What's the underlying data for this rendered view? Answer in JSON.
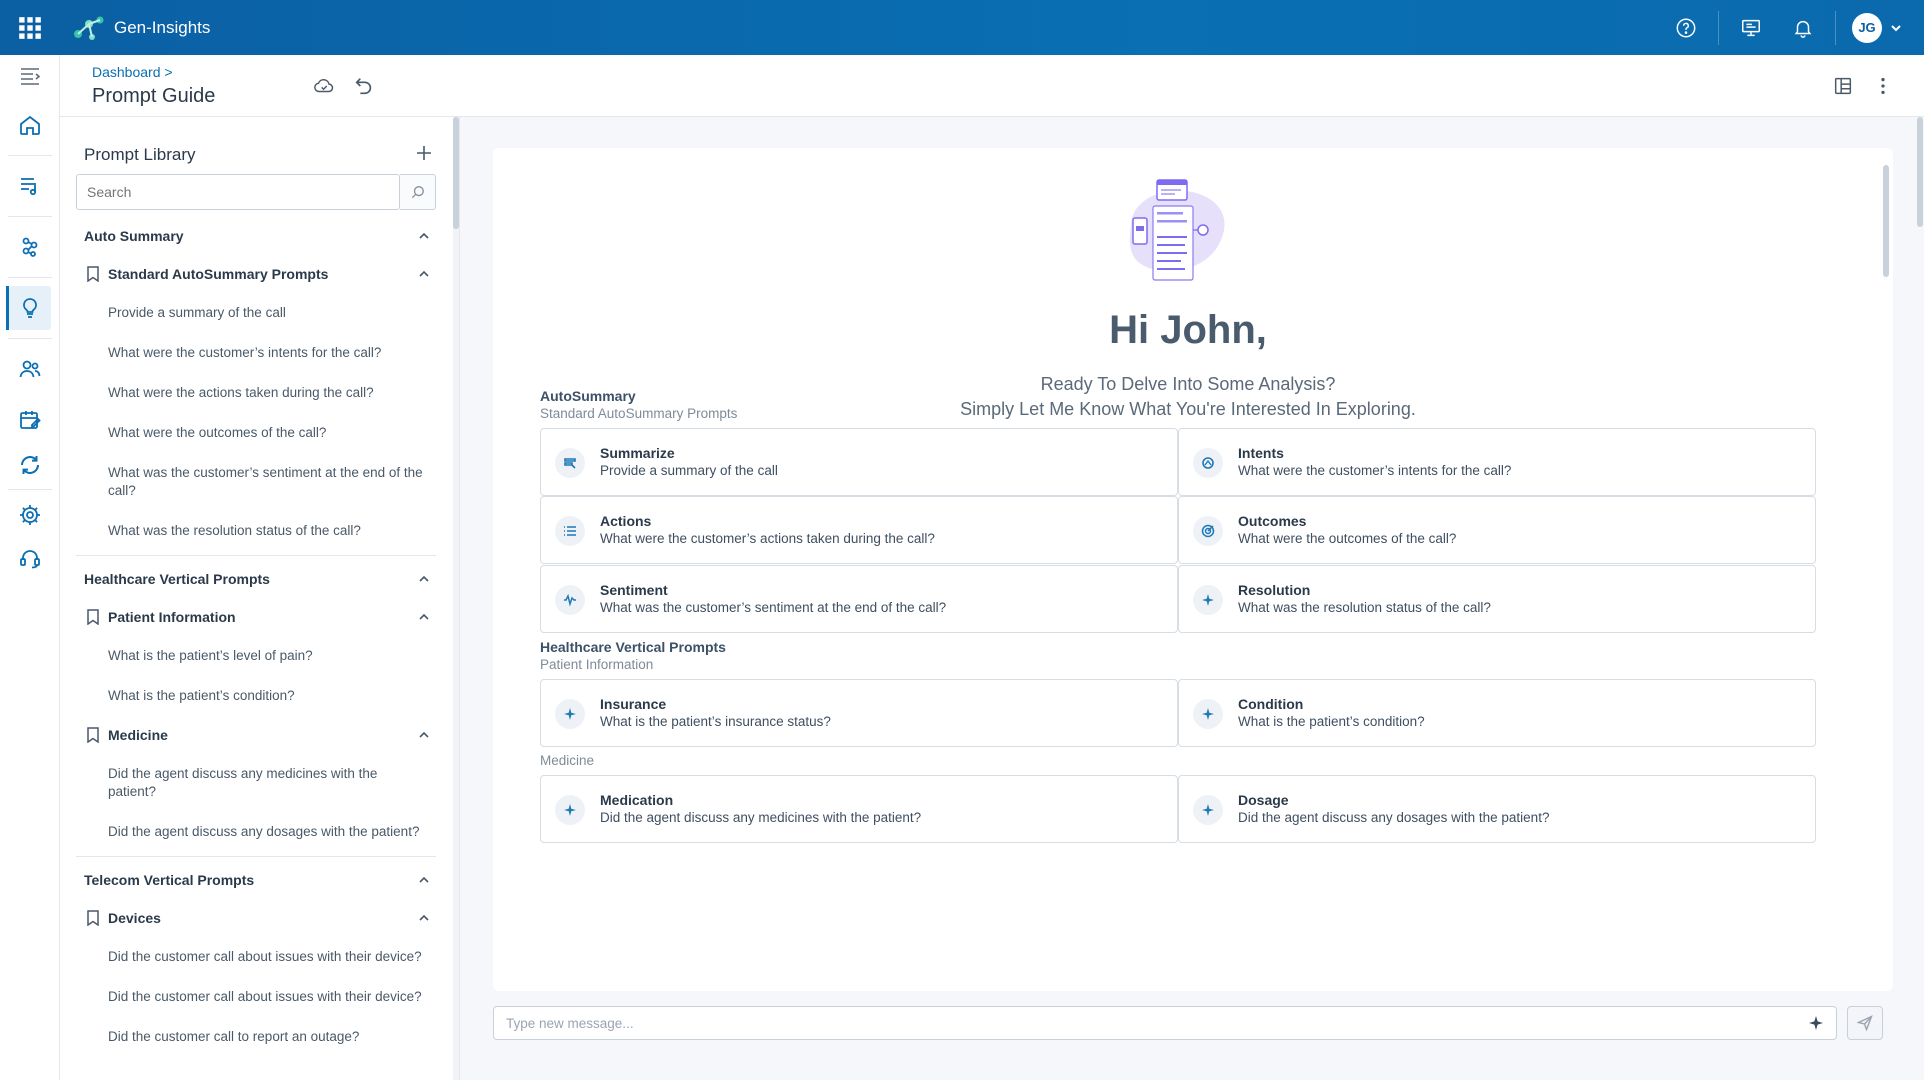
{
  "app": {
    "name": "Gen-Insights",
    "user_initials": "JG"
  },
  "header": {
    "breadcrumb": "Dashboard >",
    "title": "Prompt Guide"
  },
  "library": {
    "title": "Prompt Library",
    "search_placeholder": "Search",
    "sections": [
      {
        "label": "Auto Summary",
        "groups": [
          {
            "label": "Standard AutoSummary Prompts",
            "items": [
              "Provide a summary of the call",
              "What were the customer’s intents for the call?",
              "What were the actions taken during the call?",
              "What were the outcomes of the call?",
              "What was the customer’s sentiment at the end of the call?",
              "What was the resolution status of the call?"
            ]
          }
        ]
      },
      {
        "label": "Healthcare Vertical Prompts",
        "groups": [
          {
            "label": "Patient Information",
            "items": [
              "What is the patient’s level of pain?",
              "What is the patient’s condition?"
            ]
          },
          {
            "label": "Medicine",
            "items": [
              "Did the agent discuss any medicines with the patient?",
              "Did the agent discuss any dosages with the patient?"
            ]
          }
        ]
      },
      {
        "label": "Telecom Vertical Prompts",
        "groups": [
          {
            "label": "Devices",
            "items": [
              "Did the customer call about issues with their device?",
              "Did the customer call about issues with their device?",
              "Did the customer call to report an outage?"
            ]
          }
        ]
      }
    ]
  },
  "main": {
    "greeting": "Hi John,",
    "subtitle_line1": "Ready To Delve Into Some Analysis?",
    "subtitle_line2": "Simply Let Me Know What You're Interested In Exploring.",
    "groups": [
      {
        "title": "AutoSummary",
        "subtitle": "Standard AutoSummary Prompts",
        "cards": [
          {
            "title": "Summarize",
            "desc": "Provide a summary of the call",
            "icon": "summary-icon"
          },
          {
            "title": "Intents",
            "desc": "What were the customer’s intents for the call?",
            "icon": "intent-icon"
          },
          {
            "title": "Actions",
            "desc": "What were the customer’s actions taken during the call?",
            "icon": "list-icon"
          },
          {
            "title": "Outcomes",
            "desc": "What were the outcomes of the call?",
            "icon": "target-icon"
          },
          {
            "title": "Sentiment",
            "desc": "What was the customer’s sentiment at the end of the call?",
            "icon": "sentiment-icon"
          },
          {
            "title": "Resolution",
            "desc": "What was the resolution status of the call?",
            "icon": "sparkle-icon"
          }
        ]
      },
      {
        "title": "Healthcare Vertical Prompts",
        "subtitle": "Patient Information",
        "cards": [
          {
            "title": "Insurance",
            "desc": "What is the patient’s insurance status?",
            "icon": "sparkle-icon"
          },
          {
            "title": "Condition",
            "desc": "What is the patient’s condition?",
            "icon": "sparkle-icon"
          }
        ]
      },
      {
        "title": "",
        "subtitle": "Medicine",
        "cards": [
          {
            "title": "Medication",
            "desc": "Did the agent discuss any medicines with the patient?",
            "icon": "sparkle-icon"
          },
          {
            "title": "Dosage",
            "desc": "Did the agent discuss any dosages with the patient?",
            "icon": "sparkle-icon"
          }
        ]
      }
    ]
  },
  "composer": {
    "placeholder": "Type new message..."
  },
  "colors": {
    "brand": "#0b6fb3",
    "text_dark": "#2b3a4a",
    "icon_blue": "#1f78b8"
  }
}
